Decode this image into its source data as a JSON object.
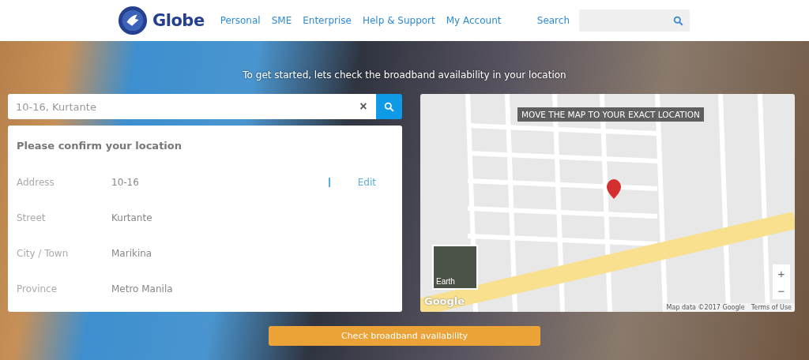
{
  "header": {
    "logo_text": "Globe",
    "nav": [
      {
        "label": "Personal"
      },
      {
        "label": "SME"
      },
      {
        "label": "Enterprise"
      },
      {
        "label": "Help & Support"
      },
      {
        "label": "My Account"
      }
    ],
    "search_label": "Search"
  },
  "headline": "To get started, lets check the broadband availability in your location",
  "location_search": {
    "value": "10-16, Kurtante",
    "clear": "×"
  },
  "confirm_card": {
    "title": "Please confirm your location",
    "fields": [
      {
        "label": "Address",
        "value": "10-16",
        "edit": "Edit"
      },
      {
        "label": "Street",
        "value": "Kurtante"
      },
      {
        "label": "City / Town",
        "value": "Marikina"
      },
      {
        "label": "Province",
        "value": "Metro Manila"
      }
    ]
  },
  "map": {
    "banner": "MOVE THE MAP TO YOUR EXACT LOCATION",
    "layer_toggle": "Earth",
    "zoom_in": "+",
    "zoom_out": "−",
    "logo": "Google",
    "attribution": "Map data ©2017 Google",
    "terms": "Terms of Use"
  },
  "submit_button": "Check broadband availability"
}
